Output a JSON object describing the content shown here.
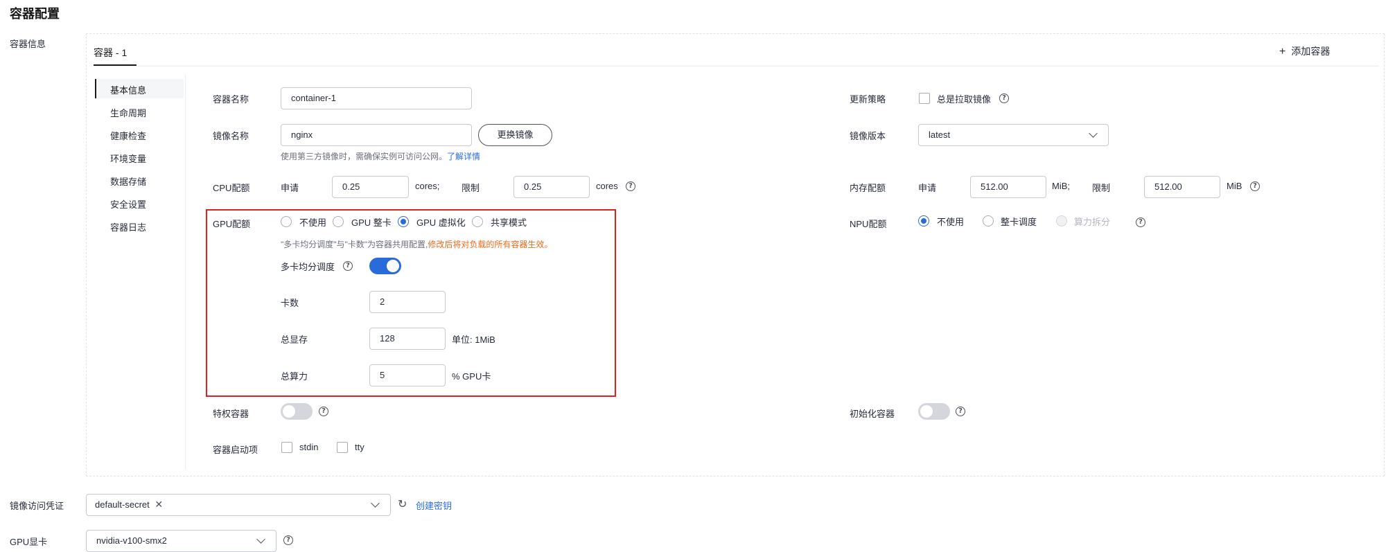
{
  "page": {
    "title": "容器配置"
  },
  "container_info": {
    "label": "容器信息",
    "tab": "容器 - 1",
    "add_container": "添加容器",
    "nav": [
      "基本信息",
      "生命周期",
      "健康检查",
      "环境变量",
      "数据存储",
      "安全设置",
      "容器日志"
    ],
    "container_name": {
      "label": "容器名称",
      "value": "container-1"
    },
    "update_policy": {
      "label": "更新策略",
      "option": "总是拉取镜像"
    },
    "image_name": {
      "label": "镜像名称",
      "value": "nginx",
      "change_button": "更换镜像",
      "hint": "使用第三方镜像时，需确保实例可访问公网。",
      "hint_link": "了解详情"
    },
    "image_version": {
      "label": "镜像版本",
      "value": "latest"
    },
    "cpu": {
      "label": "CPU配额",
      "request_label": "申请",
      "request_value": "0.25",
      "request_unit": "cores;",
      "limit_label": "限制",
      "limit_value": "0.25",
      "limit_unit": "cores"
    },
    "memory": {
      "label": "内存配额",
      "request_label": "申请",
      "request_value": "512.00",
      "request_unit": "MiB;",
      "limit_label": "限制",
      "limit_value": "512.00",
      "limit_unit": "MiB"
    },
    "gpu": {
      "label": "GPU配额",
      "options": [
        "不使用",
        "GPU 整卡",
        "GPU 虚拟化",
        "共享模式"
      ],
      "selected": "GPU 虚拟化",
      "note": "\"多卡均分调度\"与\"卡数\"为容器共用配置,",
      "note_warning": "修改后将对负载的所有容器生效。",
      "multi_card_label": "多卡均分调度",
      "multi_card_enabled": true,
      "card_count_label": "卡数",
      "card_count_value": "2",
      "total_memory_label": "总显存",
      "total_memory_value": "128",
      "total_memory_unit": "单位: 1MiB",
      "total_compute_label": "总算力",
      "total_compute_value": "5",
      "total_compute_unit": "% GPU卡",
      "highlight_color": "#e02020"
    },
    "npu": {
      "label": "NPU配额",
      "options": [
        "不使用",
        "整卡调度",
        "算力拆分"
      ],
      "selected": "不使用"
    },
    "privileged": {
      "label": "特权容器",
      "enabled": false
    },
    "init_container": {
      "label": "初始化容器",
      "enabled": false
    },
    "startup": {
      "label": "容器启动项",
      "options": [
        "stdin",
        "tty"
      ]
    }
  },
  "registry_secret": {
    "label": "镜像访问凭证",
    "tag": "default-secret",
    "create_link": "创建密钥"
  },
  "gpu_card": {
    "label": "GPU显卡",
    "value": "nvidia-v100-smx2"
  },
  "colors": {
    "accent": "#2a6bdc",
    "warning": "#f06a1a",
    "border": "#c6c9d0"
  }
}
